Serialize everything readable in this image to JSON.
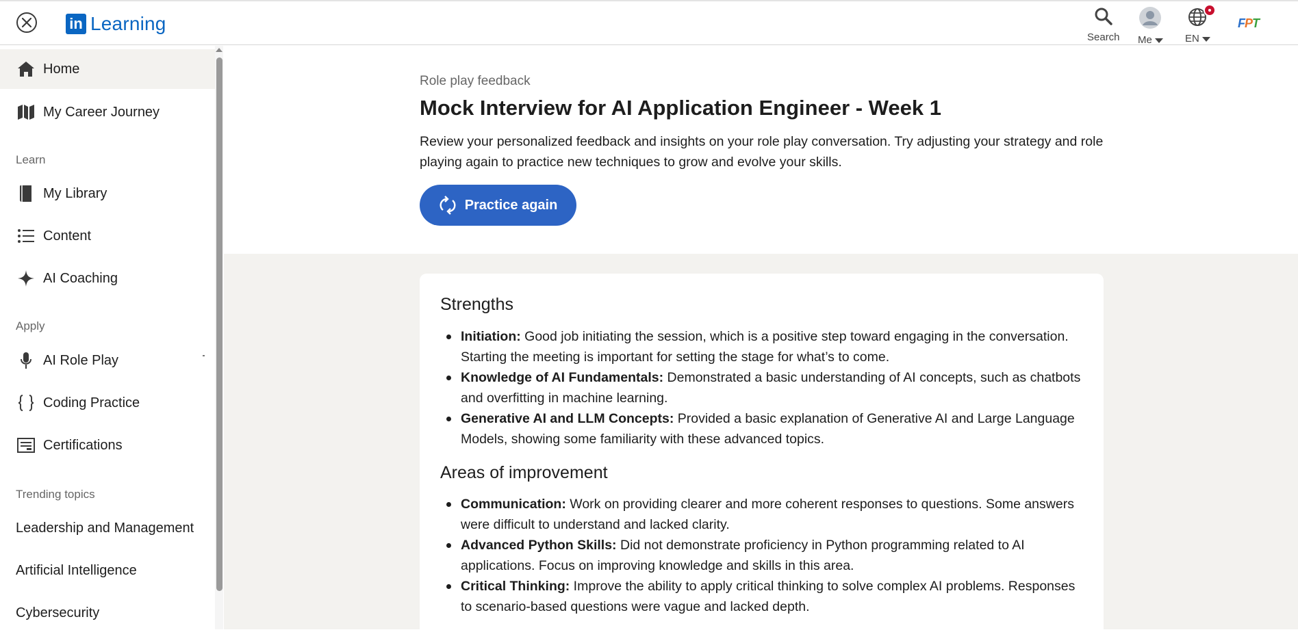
{
  "header": {
    "logo_letters": "in",
    "logo_text": "Learning",
    "search_label": "Search",
    "me_label": "Me",
    "lang_label": "EN",
    "org_logo_text": "FPT",
    "colors": {
      "brand": "#0a66c2",
      "badge": "#c8102e"
    }
  },
  "sidebar": {
    "items": [
      {
        "label": "Home",
        "icon": "home-icon"
      },
      {
        "label": "My Career Journey",
        "icon": "map-icon"
      }
    ],
    "learn_heading": "Learn",
    "learn_items": [
      {
        "label": "My Library",
        "icon": "book-icon"
      },
      {
        "label": "Content",
        "icon": "list-icon"
      },
      {
        "label": "AI Coaching",
        "icon": "sparkle-icon"
      }
    ],
    "apply_heading": "Apply",
    "apply_items": [
      {
        "label": "AI Role Play",
        "icon": "microphone-icon"
      },
      {
        "label": "Coding Practice",
        "icon": "braces-icon"
      },
      {
        "label": "Certifications",
        "icon": "certificate-icon"
      }
    ],
    "trending_heading": "Trending topics",
    "topics": [
      "Leadership and Management",
      "Artificial Intelligence",
      "Cybersecurity"
    ]
  },
  "main": {
    "eyebrow": "Role play feedback",
    "title": "Mock Interview for AI Application Engineer - Week 1",
    "description": "Review your personalized feedback and insights on your role play conversation. Try adjusting your strategy and role playing again to practice new techniques to grow and evolve your skills.",
    "practice_button": "Practice again",
    "accent_color": "#2d64c4",
    "strengths": {
      "title": "Strengths",
      "items": [
        {
          "term": "Initiation:",
          "text": " Good job initiating the session, which is a positive step toward engaging in the conversation. Starting the meeting is important for setting the stage for what’s to come."
        },
        {
          "term": "Knowledge of AI Fundamentals:",
          "text": " Demonstrated a basic understanding of AI concepts, such as chatbots and overfitting in machine learning."
        },
        {
          "term": "Generative AI and LLM Concepts:",
          "text": " Provided a basic explanation of Generative AI and Large Language Models, showing some familiarity with these advanced topics."
        }
      ]
    },
    "improvements": {
      "title": "Areas of improvement",
      "items": [
        {
          "term": "Communication:",
          "text": " Work on providing clearer and more coherent responses to questions. Some answers were difficult to understand and lacked clarity."
        },
        {
          "term": "Advanced Python Skills:",
          "text": " Did not demonstrate proficiency in Python programming related to AI applications. Focus on improving knowledge and skills in this area."
        },
        {
          "term": "Critical Thinking:",
          "text": " Improve the ability to apply critical thinking to solve complex AI problems. Responses to scenario-based questions were vague and lacked depth."
        }
      ]
    }
  }
}
